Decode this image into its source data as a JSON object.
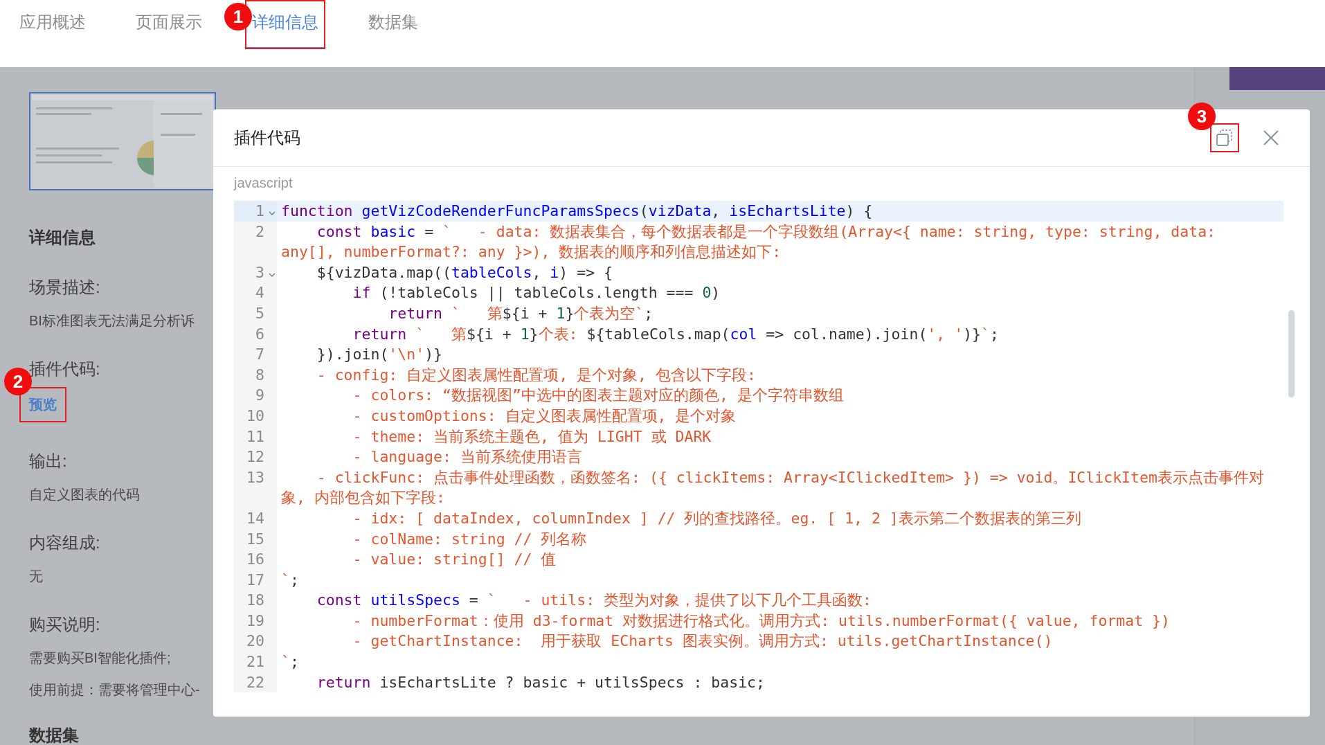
{
  "tabs": [
    {
      "label": "应用概述",
      "selected": false
    },
    {
      "label": "页面展示",
      "selected": false
    },
    {
      "label": "详细信息",
      "selected": true,
      "marker": "1"
    },
    {
      "label": "数据集",
      "selected": false
    }
  ],
  "details": {
    "heading": "详细信息",
    "sections": [
      {
        "label": "场景描述:",
        "kind": "text",
        "lines": [
          "BI标准图表无法满足分析诉"
        ]
      },
      {
        "label": "插件代码:",
        "kind": "link",
        "link": "预览",
        "marker": "2"
      },
      {
        "label": "输出:",
        "kind": "text",
        "lines": [
          "自定义图表的代码"
        ]
      },
      {
        "label": "内容组成:",
        "kind": "text",
        "lines": [
          "无"
        ]
      },
      {
        "label": "购买说明:",
        "kind": "text",
        "lines": [
          "需要购买BI智能化插件;",
          "使用前提：需要将管理中心-"
        ]
      }
    ],
    "next_heading": "数据集"
  },
  "modal": {
    "title": "插件代码",
    "copy_marker": "3",
    "language": "javascript",
    "lines": [
      {
        "number": "1",
        "foldable": true,
        "current": true,
        "rows": [
          [
            {
              "kind": "kw",
              "text": "function"
            },
            {
              "kind": "plain",
              "text": " "
            },
            {
              "kind": "def",
              "text": "getVizCodeRenderFuncParamsSpecs"
            },
            {
              "kind": "plain",
              "text": "("
            },
            {
              "kind": "def",
              "text": "vizData"
            },
            {
              "kind": "plain",
              "text": ", "
            },
            {
              "kind": "def",
              "text": "isEchartsLite"
            },
            {
              "kind": "plain",
              "text": ") {"
            }
          ]
        ]
      },
      {
        "number": "2",
        "foldable": false,
        "current": false,
        "rows": [
          [
            {
              "kind": "plain",
              "text": "    "
            },
            {
              "kind": "kw",
              "text": "const"
            },
            {
              "kind": "plain",
              "text": " "
            },
            {
              "kind": "def",
              "text": "basic"
            },
            {
              "kind": "plain",
              "text": " = "
            },
            {
              "kind": "str",
              "text": "`   - data: 数据表集合，每个数据表都是一个字段数组(Array<{ name: string, type: string, data:"
            }
          ],
          [
            {
              "kind": "str",
              "text": "any[], numberFormat?: any }>), 数据表的顺序和列信息描述如下:"
            }
          ]
        ]
      },
      {
        "number": "3",
        "foldable": true,
        "current": false,
        "rows": [
          [
            {
              "kind": "plain",
              "text": "    ${vizData.map(("
            },
            {
              "kind": "def",
              "text": "tableCols"
            },
            {
              "kind": "plain",
              "text": ", "
            },
            {
              "kind": "def",
              "text": "i"
            },
            {
              "kind": "plain",
              "text": ") => {"
            }
          ]
        ]
      },
      {
        "number": "4",
        "foldable": false,
        "current": false,
        "rows": [
          [
            {
              "kind": "plain",
              "text": "        "
            },
            {
              "kind": "kw",
              "text": "if"
            },
            {
              "kind": "plain",
              "text": " (!tableCols || tableCols.length === "
            },
            {
              "kind": "num",
              "text": "0"
            },
            {
              "kind": "plain",
              "text": ")"
            }
          ]
        ]
      },
      {
        "number": "5",
        "foldable": false,
        "current": false,
        "rows": [
          [
            {
              "kind": "plain",
              "text": "            "
            },
            {
              "kind": "kw",
              "text": "return"
            },
            {
              "kind": "plain",
              "text": " "
            },
            {
              "kind": "str",
              "text": "`   第"
            },
            {
              "kind": "plain",
              "text": "${i + "
            },
            {
              "kind": "num",
              "text": "1"
            },
            {
              "kind": "plain",
              "text": "}"
            },
            {
              "kind": "str",
              "text": "个表为空`"
            },
            {
              "kind": "plain",
              "text": ";"
            }
          ]
        ]
      },
      {
        "number": "6",
        "foldable": false,
        "current": false,
        "rows": [
          [
            {
              "kind": "plain",
              "text": "        "
            },
            {
              "kind": "kw",
              "text": "return"
            },
            {
              "kind": "plain",
              "text": " "
            },
            {
              "kind": "str",
              "text": "`   第"
            },
            {
              "kind": "plain",
              "text": "${i + "
            },
            {
              "kind": "num",
              "text": "1"
            },
            {
              "kind": "plain",
              "text": "}"
            },
            {
              "kind": "str",
              "text": "个表: "
            },
            {
              "kind": "plain",
              "text": "${tableCols.map("
            },
            {
              "kind": "def",
              "text": "col"
            },
            {
              "kind": "plain",
              "text": " => col.name).join("
            },
            {
              "kind": "str",
              "text": "', '"
            },
            {
              "kind": "plain",
              "text": ")}"
            },
            {
              "kind": "str",
              "text": "`"
            },
            {
              "kind": "plain",
              "text": ";"
            }
          ]
        ]
      },
      {
        "number": "7",
        "foldable": false,
        "current": false,
        "rows": [
          [
            {
              "kind": "plain",
              "text": "    }).join("
            },
            {
              "kind": "str",
              "text": "'\\n'"
            },
            {
              "kind": "plain",
              "text": ")}"
            }
          ]
        ]
      },
      {
        "number": "8",
        "foldable": false,
        "current": false,
        "rows": [
          [
            {
              "kind": "str",
              "text": "    - config: 自定义图表属性配置项, 是个对象, 包含以下字段:"
            }
          ]
        ]
      },
      {
        "number": "9",
        "foldable": false,
        "current": false,
        "rows": [
          [
            {
              "kind": "str",
              "text": "        - colors: “数据视图”中选中的图表主题对应的颜色, 是个字符串数组"
            }
          ]
        ]
      },
      {
        "number": "10",
        "foldable": false,
        "current": false,
        "rows": [
          [
            {
              "kind": "str",
              "text": "        - customOptions: 自定义图表属性配置项, 是个对象"
            }
          ]
        ]
      },
      {
        "number": "11",
        "foldable": false,
        "current": false,
        "rows": [
          [
            {
              "kind": "str",
              "text": "        - theme: 当前系统主题色, 值为 LIGHT 或 DARK"
            }
          ]
        ]
      },
      {
        "number": "12",
        "foldable": false,
        "current": false,
        "rows": [
          [
            {
              "kind": "str",
              "text": "        - language: 当前系统使用语言"
            }
          ]
        ]
      },
      {
        "number": "13",
        "foldable": false,
        "current": false,
        "rows": [
          [
            {
              "kind": "str",
              "text": "    - clickFunc: 点击事件处理函数，函数签名: ({ clickItems: Array<IClickedItem> }) => void。IClickItem表示点击事件对"
            }
          ],
          [
            {
              "kind": "str",
              "text": "象, 内部包含如下字段:"
            }
          ]
        ]
      },
      {
        "number": "14",
        "foldable": false,
        "current": false,
        "rows": [
          [
            {
              "kind": "str",
              "text": "        - idx: [ dataIndex, columnIndex ] // 列的查找路径。eg. [ 1, 2 ]表示第二个数据表的第三列"
            }
          ]
        ]
      },
      {
        "number": "15",
        "foldable": false,
        "current": false,
        "rows": [
          [
            {
              "kind": "str",
              "text": "        - colName: string // 列名称"
            }
          ]
        ]
      },
      {
        "number": "16",
        "foldable": false,
        "current": false,
        "rows": [
          [
            {
              "kind": "str",
              "text": "        - value: string[] // 值"
            }
          ]
        ]
      },
      {
        "number": "17",
        "foldable": false,
        "current": false,
        "rows": [
          [
            {
              "kind": "str",
              "text": "`"
            },
            {
              "kind": "plain",
              "text": ";"
            }
          ]
        ]
      },
      {
        "number": "18",
        "foldable": false,
        "current": false,
        "rows": [
          [
            {
              "kind": "plain",
              "text": "    "
            },
            {
              "kind": "kw",
              "text": "const"
            },
            {
              "kind": "plain",
              "text": " "
            },
            {
              "kind": "def",
              "text": "utilsSpecs"
            },
            {
              "kind": "plain",
              "text": " = "
            },
            {
              "kind": "str",
              "text": "`   - utils: 类型为对象，提供了以下几个工具函数:"
            }
          ]
        ]
      },
      {
        "number": "19",
        "foldable": false,
        "current": false,
        "rows": [
          [
            {
              "kind": "str",
              "text": "        - numberFormat：使用 d3-format 对数据进行格式化。调用方式: utils.numberFormat({ value, format })"
            }
          ]
        ]
      },
      {
        "number": "20",
        "foldable": false,
        "current": false,
        "rows": [
          [
            {
              "kind": "str",
              "text": "        - getChartInstance:  用于获取 ECharts 图表实例。调用方式: utils.getChartInstance()"
            }
          ]
        ]
      },
      {
        "number": "21",
        "foldable": false,
        "current": false,
        "rows": [
          [
            {
              "kind": "str",
              "text": "`"
            },
            {
              "kind": "plain",
              "text": ";"
            }
          ]
        ]
      },
      {
        "number": "22",
        "foldable": false,
        "current": false,
        "rows": [
          [
            {
              "kind": "plain",
              "text": "    "
            },
            {
              "kind": "kw",
              "text": "return"
            },
            {
              "kind": "plain",
              "text": " isEchartsLite ? basic + utilsSpecs : basic;"
            }
          ]
        ]
      }
    ]
  }
}
